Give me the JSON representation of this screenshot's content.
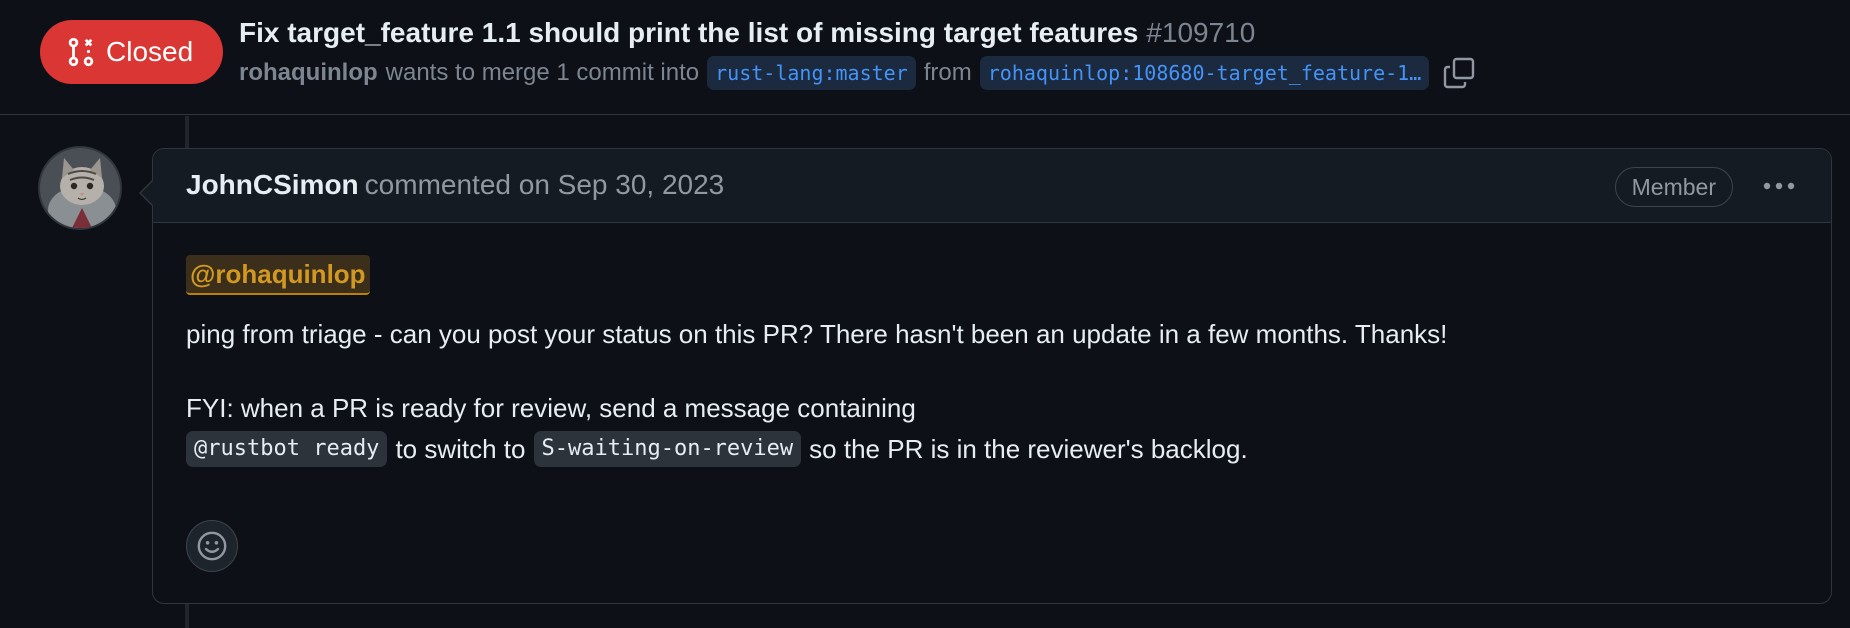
{
  "header": {
    "state_label": "Closed",
    "title": "Fix target_feature 1.1 should print the list of missing target features",
    "number": "#109710",
    "author": "rohaquinlop",
    "merge_text": "wants to merge 1 commit into",
    "base_branch": "rust-lang:master",
    "from_text": "from",
    "head_branch": "rohaquinlop:108680-target_feature-1…"
  },
  "comment": {
    "author": "JohnCSimon",
    "action_text": "commented on Sep 30, 2023",
    "role_badge": "Member",
    "mention": "@rohaquinlop",
    "paragraph1": "ping from triage - can you post your status on this PR? There hasn't been an update in a few months. Thanks!",
    "paragraph2": "FYI: when a PR is ready for review, send a message containing",
    "code1": "@rustbot ready",
    "mid_text": "to switch to",
    "code2": "S-waiting-on-review",
    "end_text": "so the PR is in the reviewer's backlog."
  },
  "colors": {
    "closed_badge": "#da3633",
    "background": "#0d1117",
    "mention": "#d29922",
    "branch_link": "#4493f8"
  },
  "icons": {
    "state": "git-pull-request-closed-icon",
    "copy": "copy-icon",
    "more": "kebab-horizontal-icon",
    "reaction": "smiley-icon",
    "avatar": "cat-avatar"
  }
}
